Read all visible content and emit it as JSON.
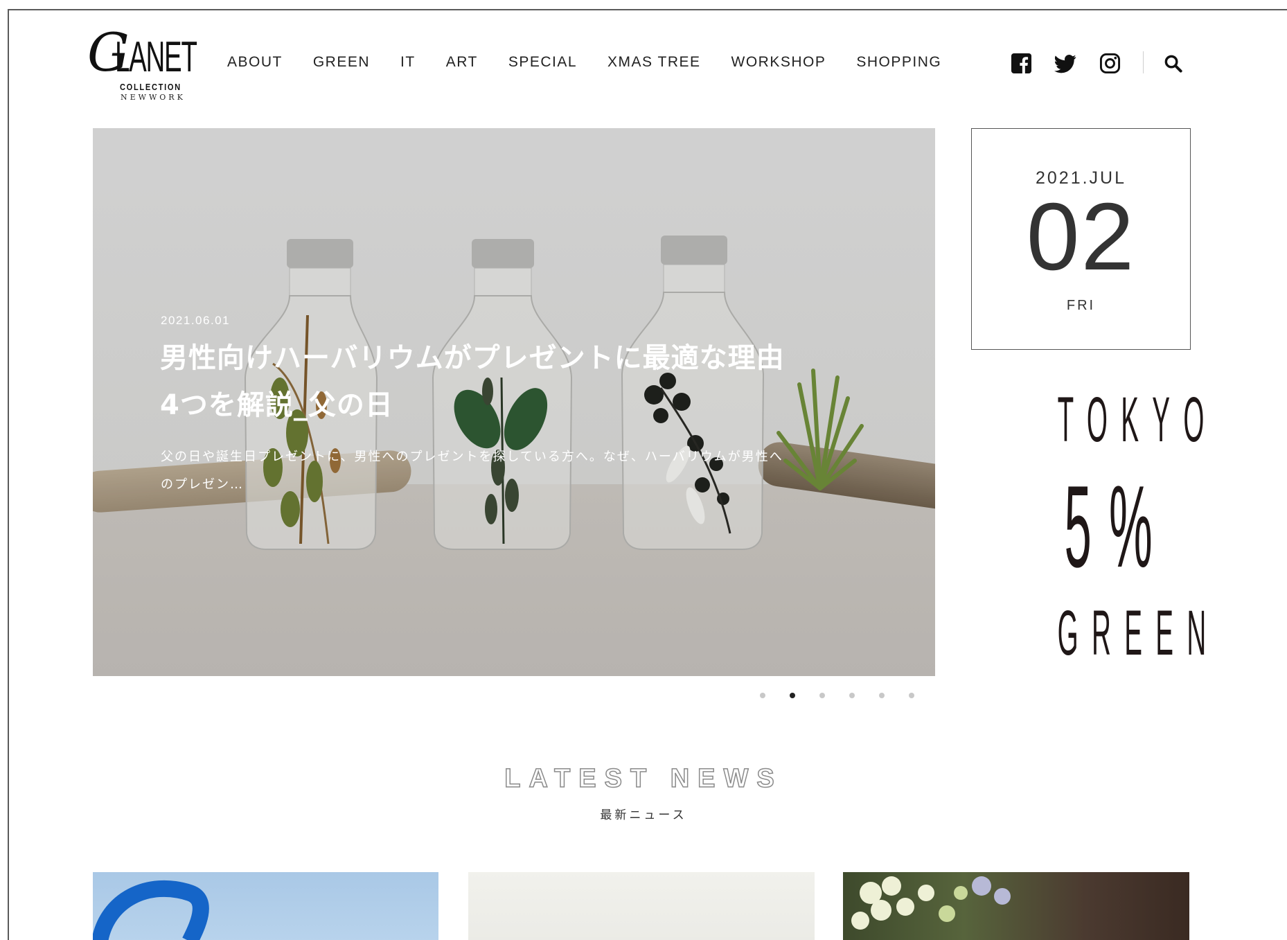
{
  "logo": {
    "mark": "G",
    "name": "LANET",
    "line2": "COLLECTION",
    "line3": "NEWWORK"
  },
  "nav": {
    "items": [
      "ABOUT",
      "GREEN",
      "IT",
      "ART",
      "SPECIAL",
      "XMAS TREE",
      "WORKSHOP",
      "SHOPPING"
    ]
  },
  "social": {
    "icons": [
      "facebook-icon",
      "twitter-icon",
      "instagram-icon",
      "search-icon"
    ]
  },
  "hero": {
    "date": "2021.06.01",
    "title": "男性向けハーバリウムがプレゼントに最適な理由4つを解説_父の日",
    "excerpt": "父の日や誕生日プレゼントに、男性へのプレゼントを探している方へ。なぜ、ハーバリウムが男性へのプレゼン…",
    "slide_count": 6,
    "active_slide": 2
  },
  "datebox": {
    "year_month": "2021.JUL",
    "day": "02",
    "weekday": "FRI"
  },
  "banner": {
    "line1": "TOKYO",
    "line2": "5%",
    "line3": "GREEN"
  },
  "news": {
    "title": "LATEST NEWS",
    "subtitle": "最新ニュース"
  },
  "colors": {
    "text": "#222222",
    "banner_text": "#1f1717",
    "dot_active": "#222222",
    "dot_inactive": "#c8c8c8"
  }
}
